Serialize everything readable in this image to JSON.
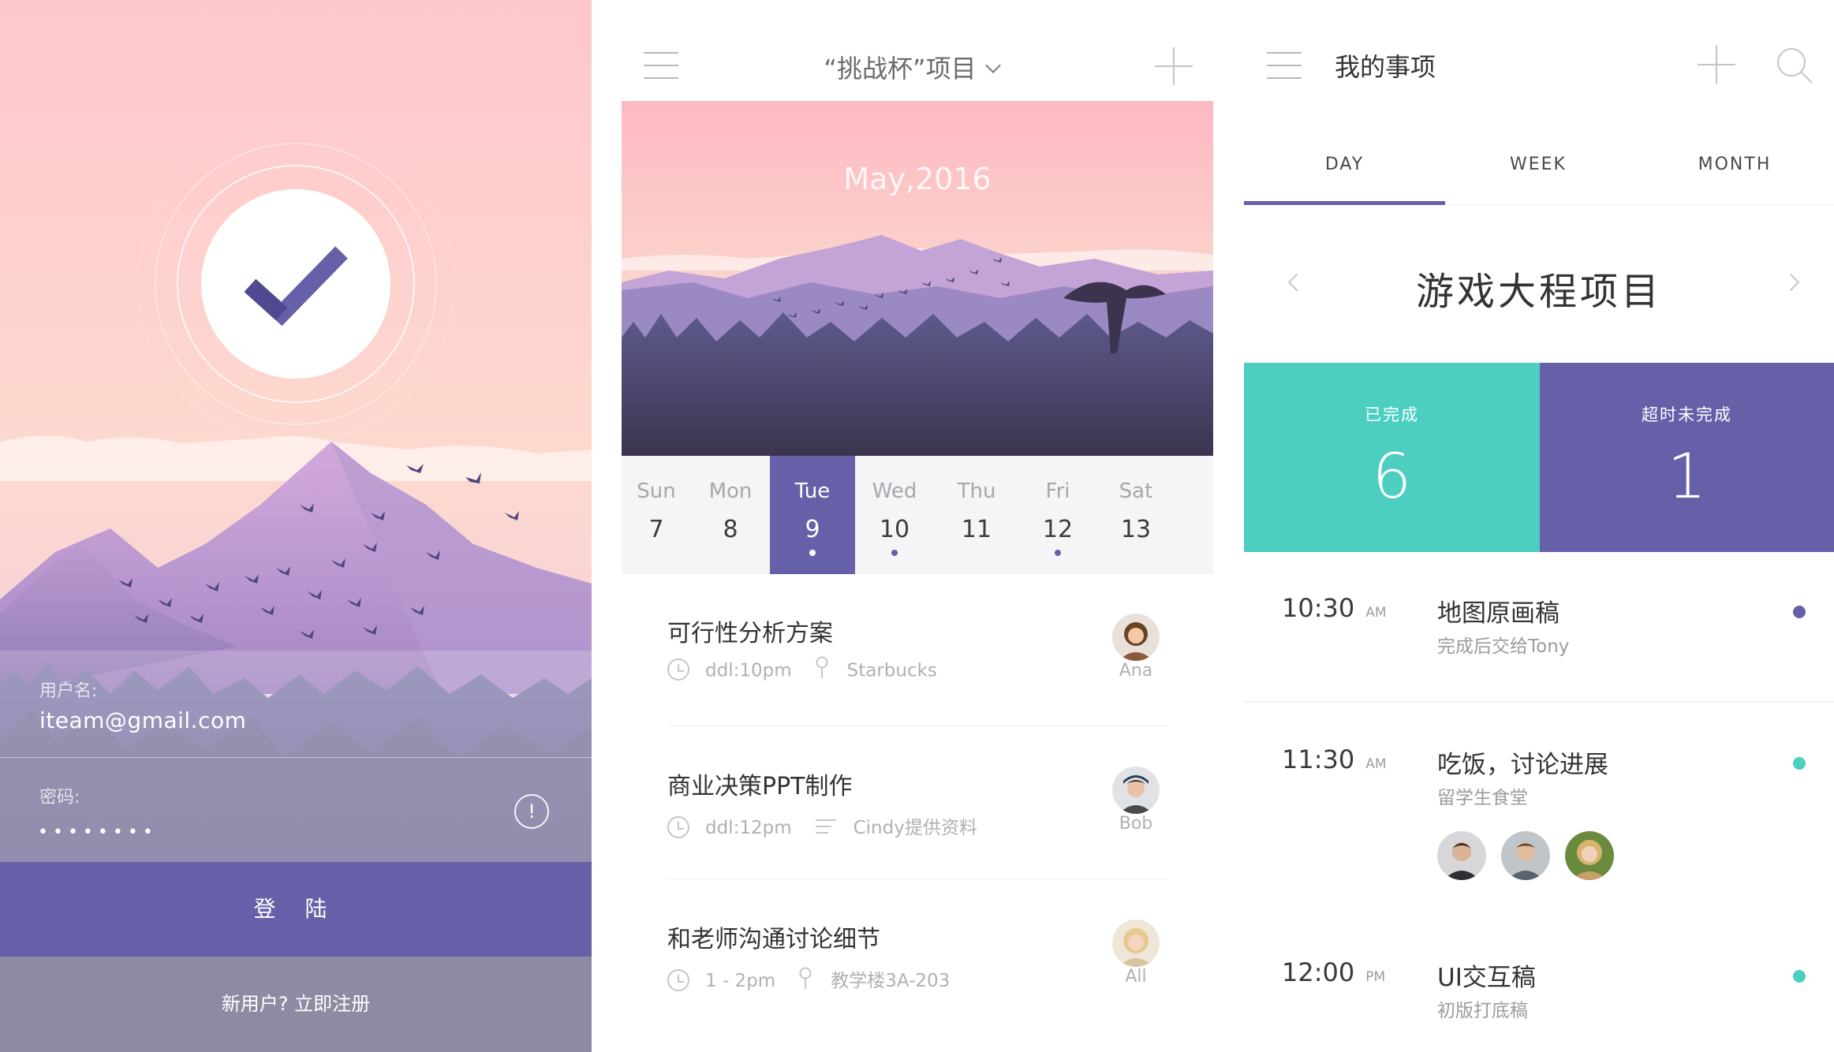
{
  "login": {
    "username_label": "用户名:",
    "username_value": "iteam@gmail.com",
    "password_label": "密码:",
    "password_dots": "••••••••",
    "alert_symbol": "!",
    "login_button": "登 陆",
    "register_link": "新用户? 立即注册",
    "accent": "#6660a8"
  },
  "project": {
    "title": "“挑战杯”项目",
    "banner_month": "May,2016",
    "week": [
      {
        "name": "Sun",
        "date": "7",
        "dot": false,
        "active": false
      },
      {
        "name": "Mon",
        "date": "8",
        "dot": false,
        "active": false
      },
      {
        "name": "Tue",
        "date": "9",
        "dot": true,
        "active": true
      },
      {
        "name": "Wed",
        "date": "10",
        "dot": true,
        "active": false
      },
      {
        "name": "Thu",
        "date": "11",
        "dot": false,
        "active": false
      },
      {
        "name": "Fri",
        "date": "12",
        "dot": true,
        "active": false
      },
      {
        "name": "Sat",
        "date": "13",
        "dot": false,
        "active": false
      }
    ],
    "tasks": [
      {
        "title": "可行性分析方案",
        "time": "ddl:10pm",
        "extra_icon": "pin-icon",
        "extra": "Starbucks",
        "who": "Ana"
      },
      {
        "title": "商业决策PPT制作",
        "time": "ddl:12pm",
        "extra_icon": "note-icon",
        "extra": "Cindy提供资料",
        "who": "Bob"
      },
      {
        "title": "和老师沟通讨论细节",
        "time": "1 - 2pm",
        "extra_icon": "pin-icon",
        "extra": "教学楼3A-203",
        "who": "All"
      }
    ]
  },
  "items": {
    "title": "我的事项",
    "tabs": [
      "DAY",
      "WEEK",
      "MONTH"
    ],
    "active_tab": "DAY",
    "project_name": "游戏大程项目",
    "stats": {
      "done_label": "已完成",
      "done_count": "6",
      "overdue_label": "超时未完成",
      "overdue_count": "1",
      "done_color": "#4ccfc0",
      "overdue_color": "#6660a8"
    },
    "events": [
      {
        "time": "10:30",
        "ampm": "AM",
        "title": "地图原画稿",
        "sub": "完成后交给Tony",
        "dot_color": "#6660a8"
      },
      {
        "time": "11:30",
        "ampm": "AM",
        "title": "吃饭，讨论进展",
        "sub": "留学生食堂",
        "dot_color": "#4ccfc0"
      },
      {
        "time": "12:00",
        "ampm": "PM",
        "title": "UI交互稿",
        "sub": "初版打底稿",
        "dot_color": "#4ccfc0"
      }
    ]
  }
}
